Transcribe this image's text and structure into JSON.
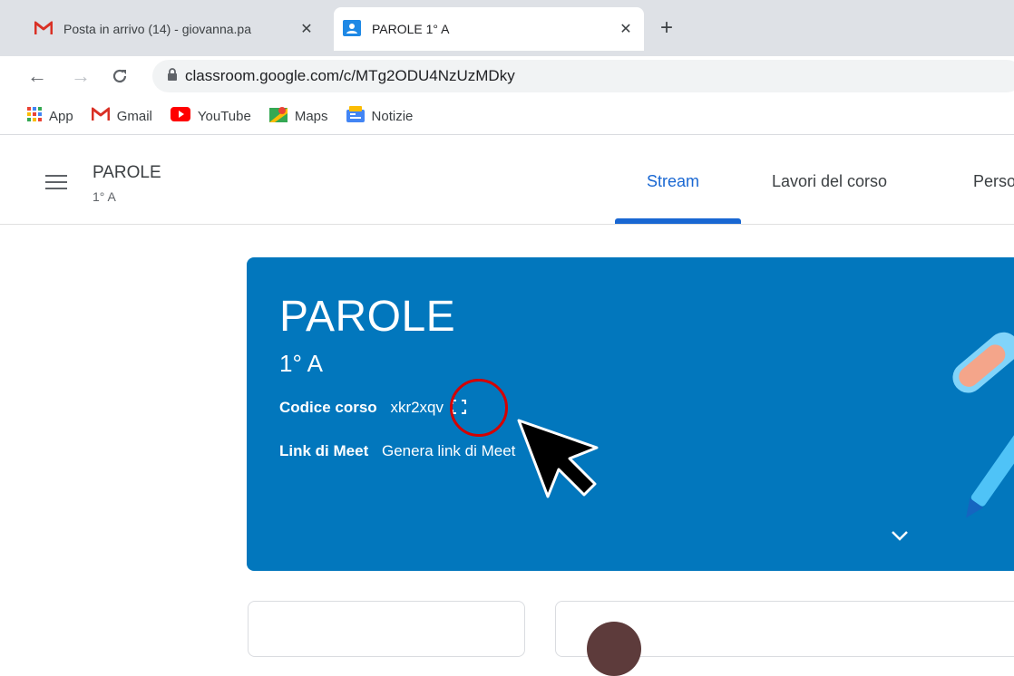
{
  "browser": {
    "tabs": [
      {
        "title": "Posta in arrivo (14) - giovanna.pa",
        "close": "✕"
      },
      {
        "title": "PAROLE 1° A",
        "close": "✕"
      }
    ],
    "new_tab": "+",
    "url": "classroom.google.com/c/MTg2ODU4NzUzMDky",
    "bookmarks": [
      "App",
      "Gmail",
      "YouTube",
      "Maps",
      "Notizie"
    ]
  },
  "classroom": {
    "class_name": "PAROLE",
    "section": "1° A",
    "nav_tabs": [
      "Stream",
      "Lavori del corso",
      "Persone"
    ]
  },
  "banner": {
    "title": "PAROLE",
    "section": "1° A",
    "class_code_label": "Codice corso",
    "class_code": "xkr2xqv",
    "meet_label": "Link di Meet",
    "meet_value": "Genera link di Meet"
  },
  "colors": {
    "banner": "#0277bd",
    "accent": "#1967d2",
    "highlight_circle": "#d50000"
  }
}
